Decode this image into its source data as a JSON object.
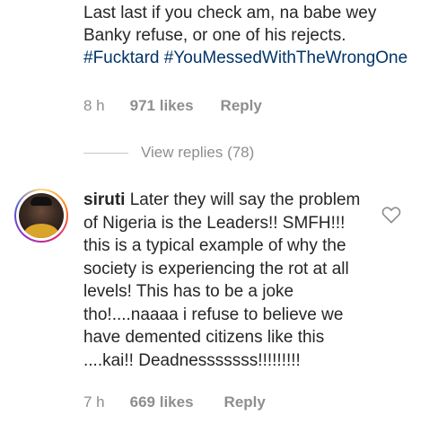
{
  "comment_top": {
    "text": "Last last if you check am, na babe wey Banky refuse, or one of his rejects.",
    "hashtags": [
      "#Fucktard",
      "#YouMessedWithTheWrongOne"
    ],
    "time": "8 h",
    "likes": "971 likes",
    "reply_label": "Reply"
  },
  "view_replies": {
    "label": "View replies (78)"
  },
  "comment_main": {
    "username": "siruti",
    "text": "Later they will say the problem of Nigeria is the Leaders!! SMFH!!! this is a typical example of why the society is experiencing the rot at all levels! This has to be a joke tho!....naaaa i refuse to believe we have demented citizens like this ....kai!! Deadnesssssss!!!!!!!!!",
    "time": "7 h",
    "likes": "669 likes",
    "reply_label": "Reply",
    "avatar_icon": "user-avatar",
    "like_icon": "heart-outline-icon"
  },
  "colors": {
    "text": "#262626",
    "muted": "#8e8e8e",
    "hashtag": "#003569"
  }
}
